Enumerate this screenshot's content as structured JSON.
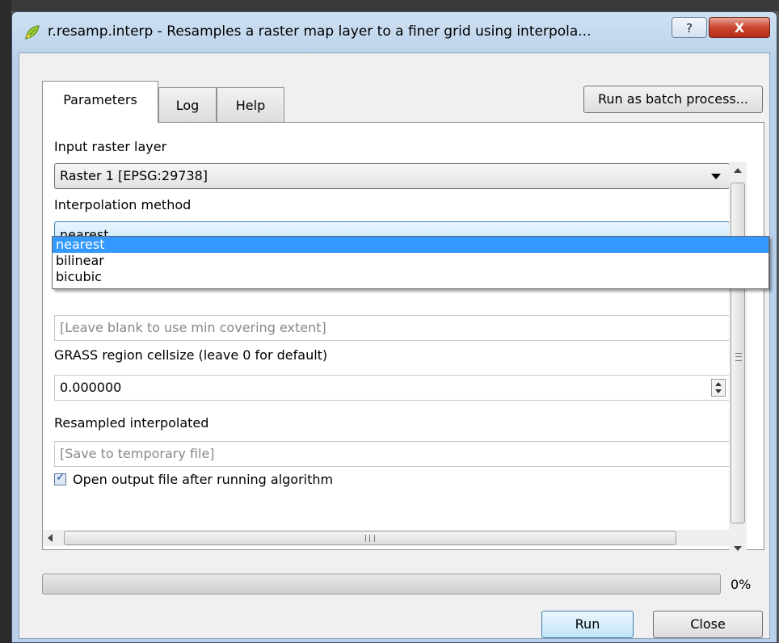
{
  "window": {
    "title": "r.resamp.interp - Resamples a raster map layer to a finer grid using interpola...",
    "help_button": "?",
    "close_button": "X"
  },
  "tabs": [
    {
      "label": "Parameters",
      "active": true
    },
    {
      "label": "Log",
      "active": false
    },
    {
      "label": "Help",
      "active": false
    }
  ],
  "batch_button": "Run as batch process...",
  "params": {
    "input_label": "Input raster layer",
    "input_value": "Raster 1 [EPSG:29738]",
    "method_label": "Interpolation method",
    "method_value": "nearest",
    "method_options": [
      "nearest",
      "bilinear",
      "bicubic"
    ],
    "method_selected_index": 0,
    "extent_placeholder": "[Leave blank to use min covering extent]",
    "cellsize_label": "GRASS region cellsize (leave 0 for default)",
    "cellsize_value": "0.000000",
    "output_label": "Resampled interpolated",
    "output_placeholder": "[Save to temporary file]",
    "open_output_label": "Open output file after running algorithm",
    "open_output_checked": true
  },
  "progress": {
    "value": 0,
    "text": "0%"
  },
  "footer": {
    "run": "Run",
    "close": "Close"
  },
  "icons": {
    "app": "qgis-leaf-icon"
  },
  "colors": {
    "selection": "#3399ff",
    "close_button": "#c9462f"
  }
}
